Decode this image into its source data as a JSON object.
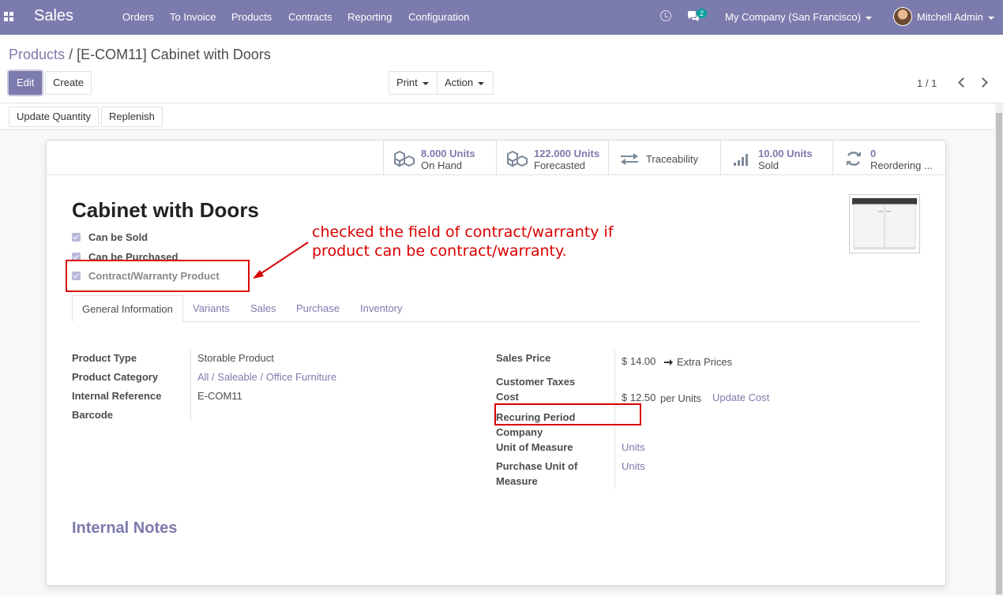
{
  "navbar": {
    "app_name": "Sales",
    "menu": [
      "Orders",
      "To Invoice",
      "Products",
      "Contracts",
      "Reporting",
      "Configuration"
    ],
    "chat_badge": "2",
    "company": "My Company (San Francisco)",
    "user": "Mitchell Admin",
    "color": "#7c7bad"
  },
  "breadcrumb": {
    "parent": "Products",
    "separator": "/",
    "current": "[E-COM11] Cabinet with Doors"
  },
  "control": {
    "edit": "Edit",
    "create": "Create",
    "print": "Print",
    "action": "Action",
    "pager": "1 / 1"
  },
  "status_buttons": {
    "update_quantity": "Update Quantity",
    "replenish": "Replenish"
  },
  "smart_buttons": [
    {
      "icon": "cubes-icon",
      "value": "8.000 Units",
      "label": "On Hand"
    },
    {
      "icon": "cubes-icon",
      "value": "122.000 Units",
      "label": "Forecasted"
    },
    {
      "icon": "exchange-icon",
      "label": "Traceability"
    },
    {
      "icon": "signal-icon",
      "value": "10.00 Units",
      "label": "Sold"
    },
    {
      "icon": "refresh-icon",
      "value": "0",
      "label": "Reordering ..."
    }
  ],
  "product": {
    "name": "Cabinet with Doors",
    "can_be_sold": "Can be Sold",
    "can_be_purchased": "Can be Purchased",
    "contract_warranty": "Contract/Warranty Product"
  },
  "annotation": {
    "text": "checked the field of contract/warranty if product can be contract/warranty.",
    "color": "#d90000"
  },
  "tabs": [
    "General Information",
    "Variants",
    "Sales",
    "Purchase",
    "Inventory"
  ],
  "general": {
    "left": {
      "product_type_label": "Product Type",
      "product_type": "Storable Product",
      "category_label": "Product Category",
      "category": "All / Saleable / Office Furniture",
      "ref_label": "Internal Reference",
      "ref": "E-COM11",
      "barcode_label": "Barcode"
    },
    "right": {
      "sales_price_label": "Sales Price",
      "sales_price": "$ 14.00",
      "extra_prices": "Extra Prices",
      "taxes_label": "Customer Taxes",
      "cost_label": "Cost",
      "cost": "$ 12.50",
      "cost_unit": "per Units",
      "update_cost": "Update Cost",
      "recurring_label": "Recuring Period",
      "company_label": "Company",
      "uom_label": "Unit of Measure",
      "uom": "Units",
      "purchase_uom_label_1": "Purchase Unit of",
      "purchase_uom_label_2": "Measure",
      "purchase_uom": "Units"
    }
  },
  "notes_title": "Internal Notes"
}
